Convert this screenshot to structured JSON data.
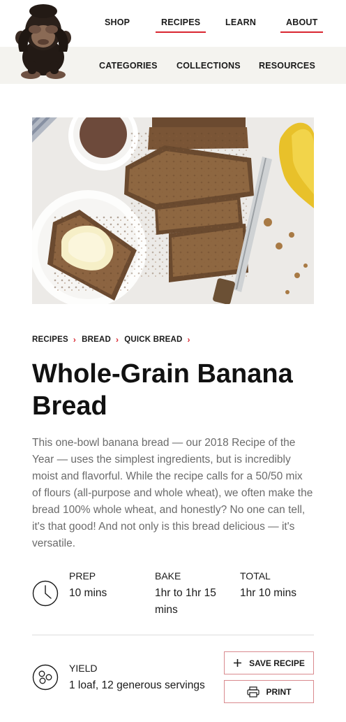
{
  "nav": {
    "primary": [
      {
        "label": "SHOP",
        "active": false
      },
      {
        "label": "RECIPES",
        "active": true
      },
      {
        "label": "LEARN",
        "active": false
      },
      {
        "label": "ABOUT",
        "active": true
      }
    ],
    "secondary": [
      {
        "label": "CATEGORIES"
      },
      {
        "label": "COLLECTIONS"
      },
      {
        "label": "RESOURCES"
      }
    ]
  },
  "breadcrumb": [
    "RECIPES",
    "BREAD",
    "QUICK BREAD"
  ],
  "recipe": {
    "title": "Whole-Grain Banana Bread",
    "description": "This one-bowl banana bread — our 2018 Recipe of the Year — uses the simplest ingredients, but is incredibly moist and flavorful. While the recipe calls for a 50/50 mix of flours (all-purpose and whole wheat), we often make the bread 100% whole wheat, and honestly? No one can tell, it's that good! And not only is this bread delicious — it's versatile.",
    "times": [
      {
        "label": "PREP",
        "value": "10 mins"
      },
      {
        "label": "BAKE",
        "value": "1hr to 1hr 15 mins"
      },
      {
        "label": "TOTAL",
        "value": "1hr 10 mins"
      }
    ],
    "yield": {
      "label": "YIELD",
      "value": "1 loaf, 12 generous servings"
    }
  },
  "actions": {
    "save_label": "SAVE RECIPE",
    "print_label": "PRINT"
  },
  "icons": {
    "logo": "monkey-logo",
    "clock": "clock-icon",
    "yield": "yield-icon",
    "save": "plus-icon",
    "print": "printer-icon",
    "chevron": "chevron-right-icon"
  },
  "colors": {
    "accent": "#d92630",
    "subnav_bg": "#f4f3ef",
    "body_text": "#6b6b6b"
  }
}
